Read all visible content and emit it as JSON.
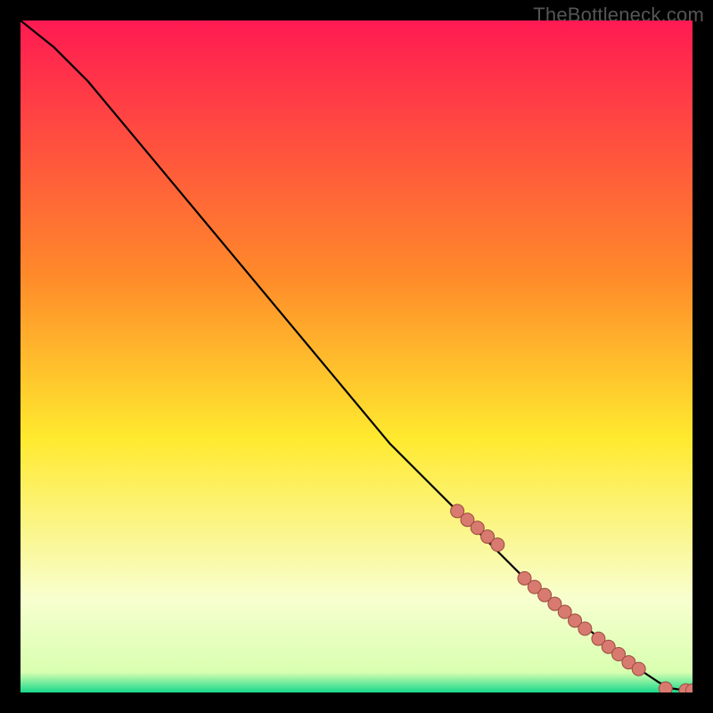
{
  "watermark": "TheBottleneck.com",
  "colors": {
    "frame": "#000000",
    "curve": "#000000",
    "marker_fill": "#d87a6f",
    "marker_stroke": "#9a4a40",
    "gradient_top": "#ff1a52",
    "gradient_mid_orange": "#ff8a2a",
    "gradient_yellow": "#ffe92e",
    "gradient_pale": "#f8ffcf",
    "gradient_green": "#17d98b"
  },
  "chart_data": {
    "type": "line",
    "title": "",
    "xlabel": "",
    "ylabel": "",
    "xlim": [
      0,
      100
    ],
    "ylim": [
      0,
      100
    ],
    "grid": false,
    "legend": false,
    "series": [
      {
        "name": "curve",
        "x": [
          0,
          5,
          10,
          15,
          20,
          25,
          30,
          35,
          40,
          45,
          50,
          55,
          60,
          65,
          70,
          75,
          80,
          85,
          90,
          92,
          95,
          97,
          99,
          100
        ],
        "y": [
          100,
          96,
          91,
          85,
          79,
          73,
          67,
          61,
          55,
          49,
          43,
          37,
          32,
          27,
          22,
          17,
          13,
          9,
          5,
          3.5,
          1.5,
          0.6,
          0.3,
          0.3
        ]
      }
    ],
    "markers": {
      "name": "dots",
      "x": [
        65,
        66.5,
        68,
        69.5,
        71,
        75,
        76.5,
        78,
        79.5,
        81,
        82.5,
        84,
        86,
        87.5,
        89,
        90.5,
        92,
        96,
        99,
        100
      ],
      "y": [
        27,
        25.7,
        24.5,
        23.2,
        22,
        17,
        15.7,
        14.5,
        13.2,
        12,
        10.7,
        9.5,
        8,
        6.8,
        5.7,
        4.5,
        3.5,
        0.6,
        0.3,
        0.3
      ]
    }
  }
}
